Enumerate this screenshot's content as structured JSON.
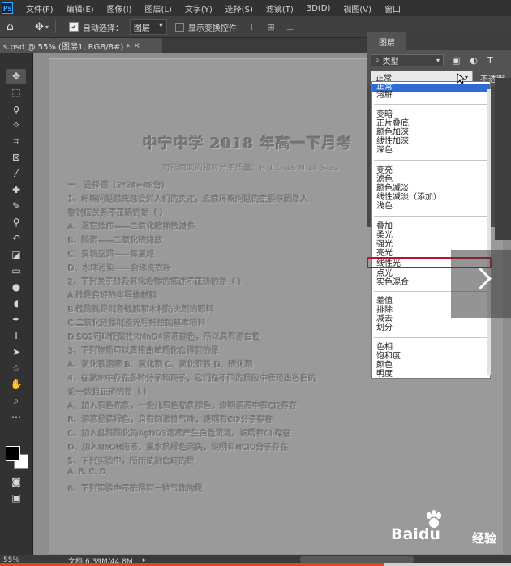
{
  "menubar": {
    "logo": "Ps",
    "items": [
      "文件(F)",
      "编辑(E)",
      "图像(I)",
      "图层(L)",
      "文字(Y)",
      "选择(S)",
      "滤镜(T)",
      "3D(D)",
      "视图(V)",
      "窗口"
    ]
  },
  "options": {
    "auto_select_label": "自动选择：",
    "auto_select_value": "图层",
    "show_transform_label": "显示变换控件"
  },
  "document": {
    "tab_title": "s.psd @ 55% (图层1, RGB/8#) *",
    "close": "×"
  },
  "layers": {
    "panel_title": "图层",
    "kind_label": "类型",
    "blend_mode": "正常",
    "opacity_label": "不透明"
  },
  "blend_menu": {
    "groups": [
      [
        "正常",
        "溶解"
      ],
      [
        "变暗",
        "正片叠底",
        "颜色加深",
        "线性加深",
        "深色"
      ],
      [
        "变亮",
        "滤色",
        "颜色减淡",
        "线性减淡（添加）",
        "浅色"
      ],
      [
        "叠加",
        "柔光",
        "强光",
        "亮光",
        "线性光",
        "点光",
        "实色混合"
      ],
      [
        "差值",
        "排除",
        "减去",
        "划分"
      ],
      [
        "色相",
        "饱和度",
        "颜色",
        "明度"
      ]
    ],
    "selected": "正常",
    "highlighted": "线性光"
  },
  "exam": {
    "title": "中宁中学 2018 年高一下月考",
    "subtitle": "可能用到的相对分子质量：H-1    O-16   N-14   S-32",
    "lines": [
      "一、选择题（2*24=48分）",
      "1、环境问题越来越受到人们的关注，造成环境问题的主要原因是人",
      "物对应关系不正确的是（  ）",
      "A、温室效应——二氧化碳排放过多",
      "B、酸雨——二氧化硫排放",
      "C、臭氧空洞——氟氯烃",
      "D、水体污染——含磷洗衣粉",
      "2、下列关于硅及其化合物的叙述不正确的是（  ）",
      "A.硅是良好的半导体材料",
      "B.硅酸钠是制备硅胶和木材防火剂的原料",
      "C.二氧化硅是制造光导纤维的基本原料",
      "D.SO2可以使酸性KMnO4溶液褪色，所以具有漂白性",
      "3、下列物质可以直接由单质化合得到的是",
      "A、氯化铁溶液    B、氯化铜    C、氯化亚铁    D、硫化铜",
      "4、在氯水中存在多种分子和离子，它们在不同的反应中表现出各自的",
      "论一致且正确的是（  ）",
      "A、加入有色布条，一会儿有色布条褪色，说明溶液中有Cl2存在",
      "B、溶液呈黄绿色，且有刺激性气味，说明有Cl2分子存在",
      "C、加入盐酸酸化的AgNO3溶液产生白色沉淀，说明有Cl-存在",
      "D、加入NaOH溶液，氯水黄绿色消失，说明有HClO分子存在",
      "5、下列实验中，所用试剂合理的是",
      "A.    B.    C.    D.",
      "6、下列实验中不能得到一种气体的是"
    ]
  },
  "status": {
    "zoom": "55%",
    "doc_info": "文档:6.39M/44.8M",
    "arrow": "▸"
  },
  "watermark": {
    "brand": "Baidu",
    "jingyan": "经验"
  },
  "video": {
    "progress": 0.75
  },
  "colors": {
    "accent_blue": "#2f6bd3",
    "highlight_red": "#c1102a",
    "progress_orange": "#e8431b"
  }
}
